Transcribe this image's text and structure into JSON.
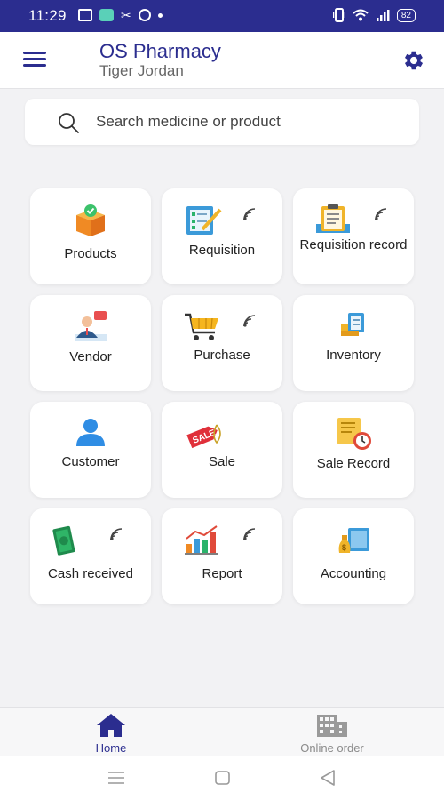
{
  "status_bar": {
    "time": "11:29",
    "battery": "82"
  },
  "app_bar": {
    "title": "OS Pharmacy",
    "subtitle": "Tiger Jordan"
  },
  "search": {
    "placeholder": "Search medicine or product"
  },
  "tiles": [
    {
      "label": "Products",
      "icon": "box-icon",
      "wifi": false
    },
    {
      "label": "Requisition",
      "icon": "checklist-icon",
      "wifi": true
    },
    {
      "label": "Requisition record",
      "icon": "clipboard-icon",
      "wifi": true
    },
    {
      "label": "Vendor",
      "icon": "vendor-icon",
      "wifi": false
    },
    {
      "label": "Purchase",
      "icon": "cart-icon",
      "wifi": true
    },
    {
      "label": "Inventory",
      "icon": "inventory-icon",
      "wifi": false
    },
    {
      "label": "Customer",
      "icon": "person-icon",
      "wifi": false
    },
    {
      "label": "Sale",
      "icon": "sale-tag-icon",
      "wifi": false
    },
    {
      "label": "Sale Record",
      "icon": "receipt-clock-icon",
      "wifi": false
    },
    {
      "label": "Cash received",
      "icon": "cash-icon",
      "wifi": true
    },
    {
      "label": "Report",
      "icon": "bar-chart-icon",
      "wifi": true
    },
    {
      "label": "Accounting",
      "icon": "accounting-icon",
      "wifi": false
    }
  ],
  "bottom_nav": {
    "home_label": "Home",
    "online_label": "Online order"
  },
  "colors": {
    "primary": "#2b2d8f",
    "background": "#f2f2f4",
    "tile": "#ffffff"
  }
}
